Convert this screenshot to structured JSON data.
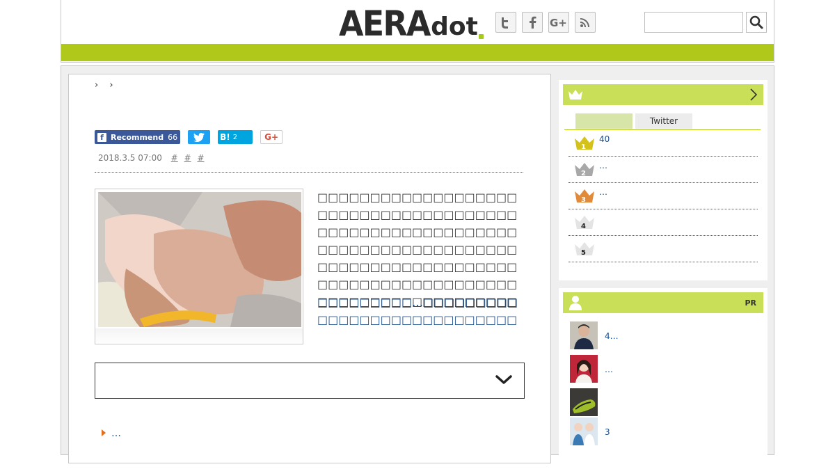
{
  "header": {
    "logo_main": "AERA",
    "logo_sub": "dot",
    "social": [
      {
        "name": "twitter-icon",
        "glyph": "t"
      },
      {
        "name": "facebook-icon",
        "glyph": "f"
      },
      {
        "name": "google-plus-icon",
        "glyph": "G+"
      },
      {
        "name": "rss-icon",
        "glyph": "rss"
      }
    ],
    "search_placeholder": "",
    "accent_color": "#afc81a"
  },
  "article": {
    "breadcrumb": "› ›",
    "share": {
      "facebook_label": "Recommend",
      "facebook_count": "66",
      "hatena_label": "B!",
      "hatena_count": "2",
      "gplus_label": "G+"
    },
    "date": "2018.3.5 07:00",
    "tags": [
      "#",
      "#",
      "#"
    ],
    "body_text": "□□□□□□□□□□□□□□□□□□□□□□□□□□□□□□□□□□□□□□□□□□□□□□□□□□□□□□□□□□□□□□□□□□□□□□□□□□□□□□□□□□□□□□□□□□□□□□□□□□□□□□□□□□□□□□□□□□□□□□□□□□□□□□□□□□□□□",
    "body_link": "□□□□□□□□□…□□□□□□□□□□□□□□□□□□□□□□□□□□□□",
    "related_link": "…"
  },
  "sidebar": {
    "ranking": {
      "tabs": [
        "",
        "Twitter"
      ],
      "items": [
        {
          "rank": "1",
          "text": "40",
          "color": "#d4c21a"
        },
        {
          "rank": "2",
          "text": "…",
          "color": "#a8a8a8"
        },
        {
          "rank": "3",
          "text": "…",
          "color": "#e08a3a"
        },
        {
          "rank": "4",
          "text": "",
          "color": "#d8d8d8"
        },
        {
          "rank": "5",
          "text": "",
          "color": "#d8d8d8"
        }
      ]
    },
    "pr": {
      "label": "PR",
      "items": [
        {
          "text": "4…"
        },
        {
          "text": "…"
        },
        {
          "text": ""
        },
        {
          "text": "3"
        }
      ]
    }
  }
}
